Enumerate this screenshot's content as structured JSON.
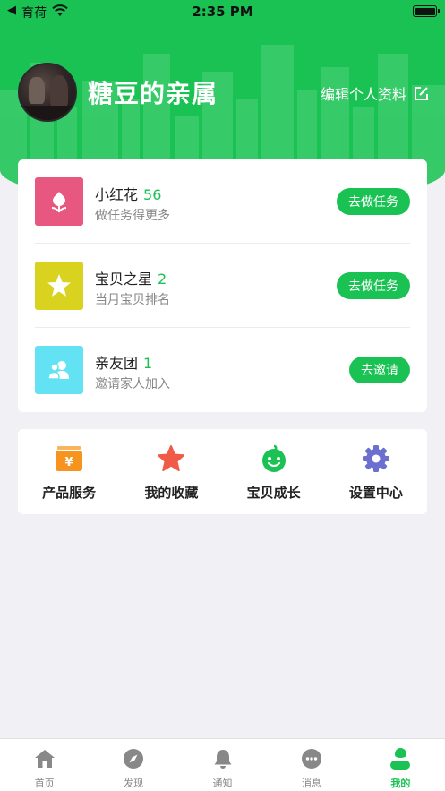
{
  "status_bar": {
    "back_arrow": "◀",
    "carrier": "育荷",
    "time": "2:35 PM"
  },
  "colors": {
    "brand_green": "#19c252",
    "flower_bg": "#e8577f",
    "star_bg": "#d9d21f",
    "family_bg": "#62e2f3",
    "product_orange": "#f7941d",
    "favorites_red": "#f05a46",
    "settings_purple": "#6a6fd0",
    "inactive_gray": "#888888"
  },
  "profile": {
    "name": "糖豆的亲属",
    "edit_label": "编辑个人资料",
    "edit_icon": "edit-square-icon"
  },
  "tasks": [
    {
      "icon": "tulip-icon",
      "title": "小红花",
      "count": "56",
      "subtitle": "做任务得更多",
      "button": "去做任务"
    },
    {
      "icon": "star-icon",
      "title": "宝贝之星",
      "count": "2",
      "subtitle": "当月宝贝排名",
      "button": "去做任务"
    },
    {
      "icon": "family-icon",
      "title": "亲友团",
      "count": "1",
      "subtitle": "邀请家人加入",
      "button": "去邀请"
    }
  ],
  "features": [
    {
      "icon": "product-box-icon",
      "label": "产品服务"
    },
    {
      "icon": "star-icon",
      "label": "我的收藏"
    },
    {
      "icon": "baby-face-icon",
      "label": "宝贝成长"
    },
    {
      "icon": "gear-icon",
      "label": "设置中心"
    }
  ],
  "tabs": [
    {
      "icon": "home-icon",
      "label": "首页",
      "active": false
    },
    {
      "icon": "compass-icon",
      "label": "发现",
      "active": false
    },
    {
      "icon": "bell-icon",
      "label": "通知",
      "active": false
    },
    {
      "icon": "chat-bubble-icon",
      "label": "消息",
      "active": false
    },
    {
      "icon": "profile-icon",
      "label": "我的",
      "active": true
    }
  ]
}
